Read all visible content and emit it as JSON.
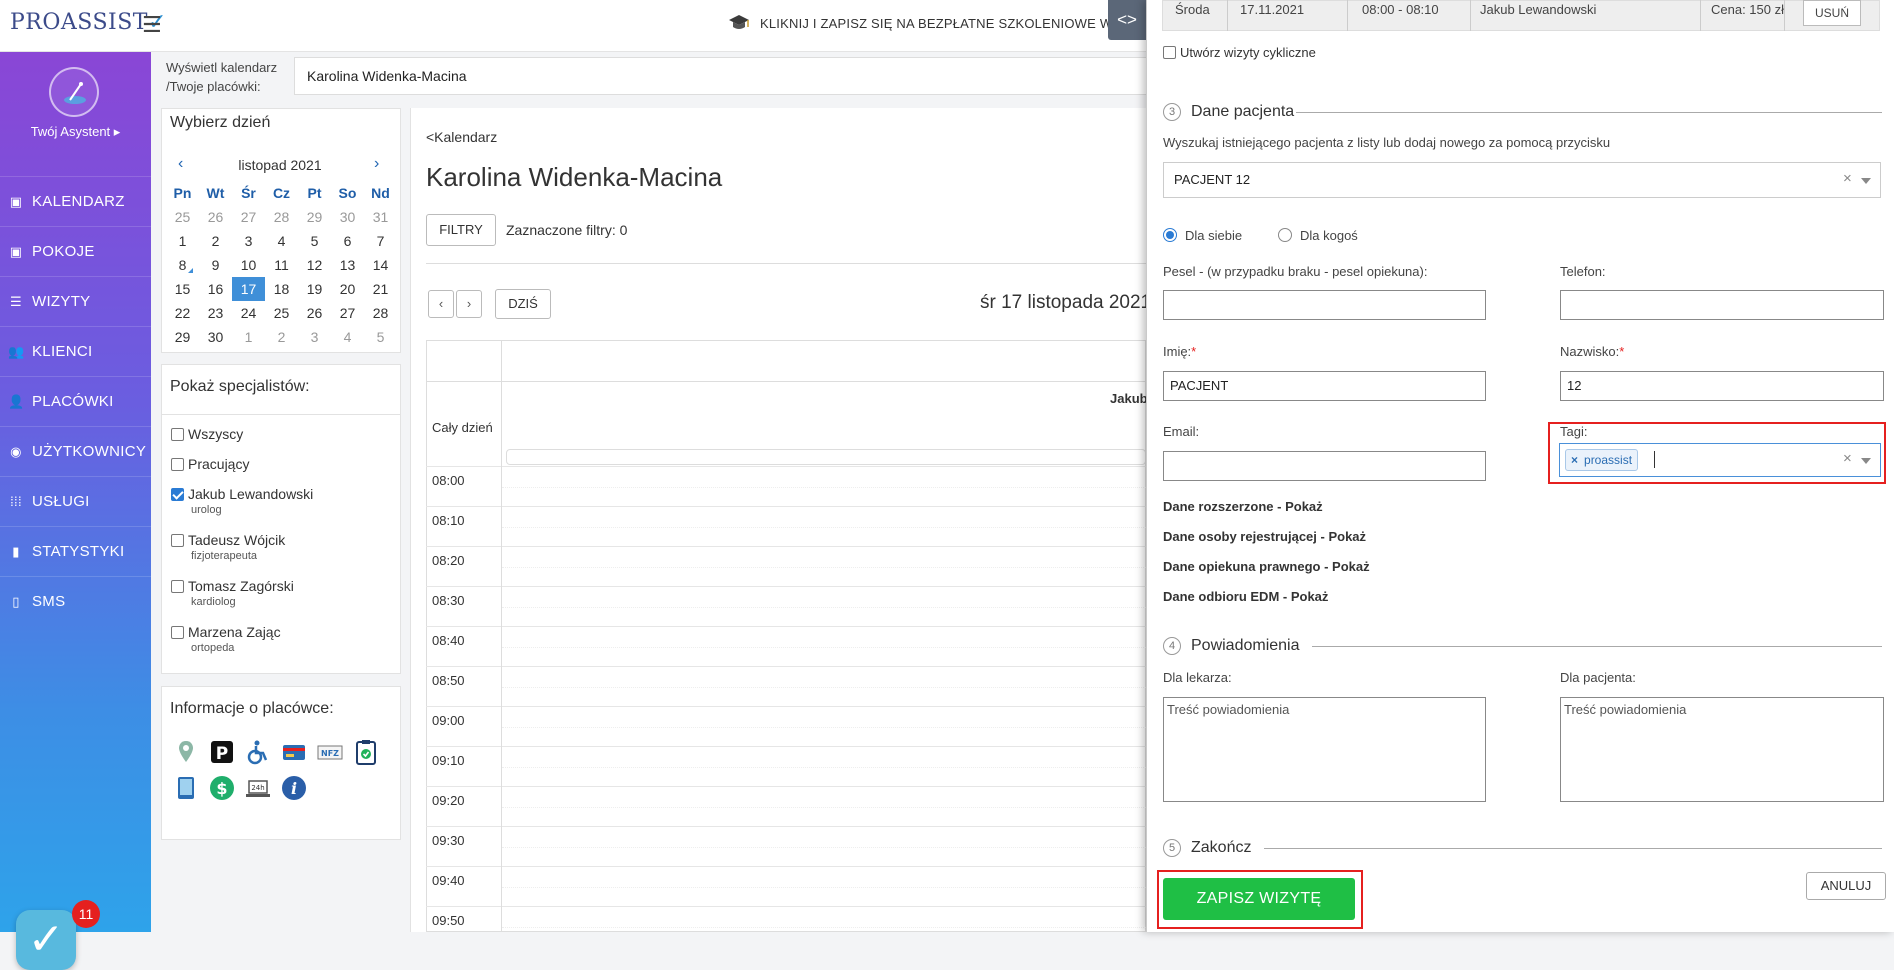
{
  "header": {
    "logo_text": "PROASSIST",
    "promo_text": "KLIKNIJ I ZAPISZ SIĘ NA BEZPŁATNE SZKOLENIOWE W",
    "toggle_label": "<>"
  },
  "sidebar": {
    "user_label": "Twój Asystent ▸",
    "items": [
      {
        "label": "KALENDARZ",
        "icon": "calendar-icon",
        "glyph": "▣"
      },
      {
        "label": "POKOJE",
        "icon": "rooms-icon",
        "glyph": "▣"
      },
      {
        "label": "WIZYTY",
        "icon": "list-icon",
        "glyph": "☰"
      },
      {
        "label": "KLIENCI",
        "icon": "users-icon",
        "glyph": "👥"
      },
      {
        "label": "PLACÓWKI",
        "icon": "user-add-icon",
        "glyph": "👤"
      },
      {
        "label": "UŻYTKOWNICY",
        "icon": "user-circle-icon",
        "glyph": "◉"
      },
      {
        "label": "USŁUGI",
        "icon": "grid-icon",
        "glyph": "⁞⁞⁞"
      },
      {
        "label": "STATYSTYKI",
        "icon": "bar-chart-icon",
        "glyph": "▮"
      },
      {
        "label": "SMS",
        "icon": "phone-icon",
        "glyph": "▯"
      }
    ],
    "notification_count": "11"
  },
  "calendar_top": {
    "show_label_line1": "Wyświetl kalendarz",
    "show_label_line2": "/Twoje placówki:",
    "facility_value": "Karolina Widenka-Macina"
  },
  "day_picker": {
    "title": "Wybierz dzień",
    "month": "listopad 2021",
    "prev": "‹",
    "next": "›",
    "weekdays": [
      "Pn",
      "Wt",
      "Śr",
      "Cz",
      "Pt",
      "So",
      "Nd"
    ],
    "days": [
      {
        "d": "25",
        "muted": true
      },
      {
        "d": "26",
        "muted": true
      },
      {
        "d": "27",
        "muted": true
      },
      {
        "d": "28",
        "muted": true
      },
      {
        "d": "29",
        "muted": true
      },
      {
        "d": "30",
        "muted": true
      },
      {
        "d": "31",
        "muted": true
      },
      {
        "d": "1"
      },
      {
        "d": "2"
      },
      {
        "d": "3"
      },
      {
        "d": "4"
      },
      {
        "d": "5"
      },
      {
        "d": "6"
      },
      {
        "d": "7"
      },
      {
        "d": "8",
        "marked": true
      },
      {
        "d": "9"
      },
      {
        "d": "10"
      },
      {
        "d": "11"
      },
      {
        "d": "12"
      },
      {
        "d": "13"
      },
      {
        "d": "14"
      },
      {
        "d": "15"
      },
      {
        "d": "16"
      },
      {
        "d": "17",
        "today": true
      },
      {
        "d": "18"
      },
      {
        "d": "19"
      },
      {
        "d": "20"
      },
      {
        "d": "21"
      },
      {
        "d": "22"
      },
      {
        "d": "23"
      },
      {
        "d": "24"
      },
      {
        "d": "25"
      },
      {
        "d": "26"
      },
      {
        "d": "27"
      },
      {
        "d": "28"
      },
      {
        "d": "29"
      },
      {
        "d": "30"
      },
      {
        "d": "1",
        "muted": true
      },
      {
        "d": "2",
        "muted": true
      },
      {
        "d": "3",
        "muted": true
      },
      {
        "d": "4",
        "muted": true
      },
      {
        "d": "5",
        "muted": true
      }
    ]
  },
  "specialists": {
    "title": "Pokaż specjalistów:",
    "items": [
      {
        "name": "Wszyscy",
        "role": "",
        "checked": false
      },
      {
        "name": "Pracujący",
        "role": "",
        "checked": false
      },
      {
        "name": "Jakub Lewandowski",
        "role": "urolog",
        "checked": true
      },
      {
        "name": "Tadeusz Wójcik",
        "role": "fizjoterapeuta",
        "checked": false
      },
      {
        "name": "Tomasz Zagórski",
        "role": "kardiolog",
        "checked": false
      },
      {
        "name": "Marzena Zając",
        "role": "ortopeda",
        "checked": false
      }
    ]
  },
  "facility_info": {
    "title": "Informacje o placówce:",
    "icons": [
      "location-pin-icon",
      "parking-icon",
      "wheelchair-icon",
      "credit-card-icon",
      "nfz-icon",
      "clipboard-check-icon",
      "tablet-icon",
      "dollar-icon",
      "24h-laptop-icon",
      "info-icon"
    ],
    "nfz_label": "NFZ",
    "h24_label": "24h",
    "parking_label": "P"
  },
  "main": {
    "back_link": "<Kalendarz",
    "owner": "Karolina Widenka-Macina",
    "filters_btn": "FILTRY",
    "filters_count": "Zaznaczone filtry: 0",
    "today_btn": "DZIŚ",
    "prev": "‹",
    "next": "›",
    "date_label": "śr 17 listopada 2021",
    "allday_label": "Cały dzień",
    "spec_column": "Jakub",
    "time_slots": [
      "08:00",
      "08:10",
      "08:20",
      "08:30",
      "08:40",
      "08:50",
      "09:00",
      "09:10",
      "09:20",
      "09:30",
      "09:40",
      "09:50"
    ]
  },
  "drawer": {
    "appointment": {
      "day": "Środa",
      "date": "17.11.2021",
      "time": "08:00 - 08:10",
      "specialist": "Jakub Lewandowski",
      "price": "Cena: 150 zł",
      "remove_btn": "USUŃ"
    },
    "cyclic_label": "Utwórz wizyty cykliczne",
    "section3": {
      "num": "3",
      "title": "Dane pacjenta"
    },
    "search_hint": "Wyszukaj istniejącego pacjenta z listy lub dodaj nowego za pomocą przycisku",
    "patient_value": "PACJENT 12",
    "radio_self": "Dla siebie",
    "radio_other": "Dla kogoś",
    "pesel_label": "Pesel - (w przypadku braku - pesel opiekuna):",
    "phone_label": "Telefon:",
    "first_name_label": "Imię:",
    "last_name_label": "Nazwisko:",
    "required_mark": "*",
    "first_name_value": "PACJENT",
    "last_name_value": "12",
    "email_label": "Email:",
    "tags_label": "Tagi:",
    "tag_value": "proassist",
    "tag_remove": "×",
    "clear": "×",
    "links": [
      "Dane rozszerzone - Pokaż",
      "Dane osoby rejestrującej - Pokaż",
      "Dane opiekuna prawnego - Pokaż",
      "Dane odbioru EDM - Pokaż"
    ],
    "section4": {
      "num": "4",
      "title": "Powiadomienia"
    },
    "for_doctor_label": "Dla lekarza:",
    "for_patient_label": "Dla pacjenta:",
    "notification_placeholder": "Treść powiadomienia",
    "section5": {
      "num": "5",
      "title": "Zakończ"
    },
    "save_btn": "ZAPISZ WIZYTĘ",
    "cancel_btn": "ANULUJ"
  }
}
